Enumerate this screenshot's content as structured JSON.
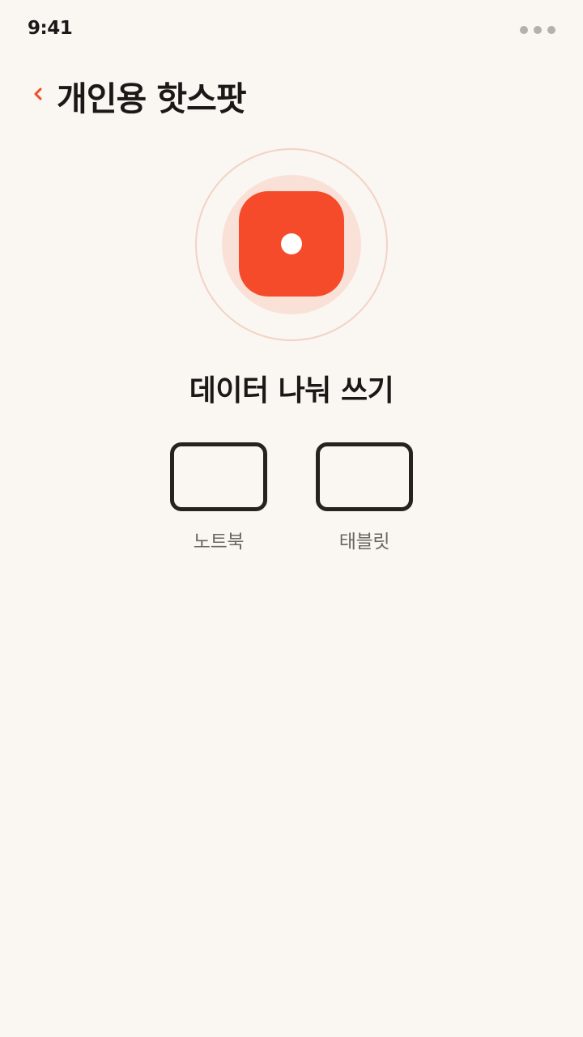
{
  "status_bar": {
    "time": "9:41",
    "menu_icon": "more-dots-icon"
  },
  "header": {
    "back_icon": "chevron-left-icon",
    "title": "개인용 핫스팟"
  },
  "hotspot": {
    "icon": "hotspot-toggle-icon",
    "accent_color": "#f54b2a",
    "ring_color": "#f9e1d8"
  },
  "share": {
    "title": "데이터 나눠 쓰기",
    "devices": [
      {
        "label": "노트북",
        "icon": "laptop-icon"
      },
      {
        "label": "태블릿",
        "icon": "tablet-icon"
      }
    ]
  },
  "colors": {
    "background": "#faf6f1",
    "text": "#1b1918",
    "secondary_text": "#6a6662",
    "accent": "#f54b2a"
  }
}
